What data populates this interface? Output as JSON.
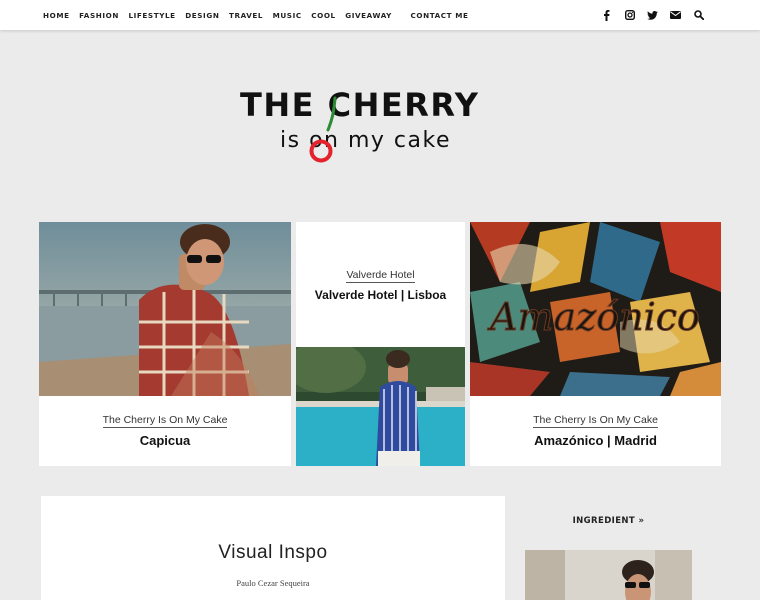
{
  "nav": {
    "items": [
      "HOME",
      "FASHION",
      "LIFESTYLE",
      "DESIGN",
      "TRAVEL",
      "MUSIC",
      "COOL",
      "GIVEAWAY"
    ],
    "contact": "CONTACT ME"
  },
  "socials": [
    "facebook-icon",
    "instagram-icon",
    "twitter-icon",
    "email-icon",
    "search-icon"
  ],
  "logo": {
    "line1": "THE CHERRY",
    "line2": "is on my cake",
    "accent_color": "#e3222d",
    "stem_color": "#2d8a35"
  },
  "featured": [
    {
      "category": "The Cherry Is On My Cake",
      "title": "Capicua"
    },
    {
      "category": "Valverde Hotel",
      "title": "Valverde Hotel | Lisboa"
    },
    {
      "category": "The Cherry Is On My Cake",
      "title": "Amazónico | Madrid"
    }
  ],
  "latest_post": {
    "title": "Visual Inspo",
    "author": "Paulo Cezar Sequeira"
  },
  "sidebar": {
    "heading": "INGREDIENT »"
  }
}
